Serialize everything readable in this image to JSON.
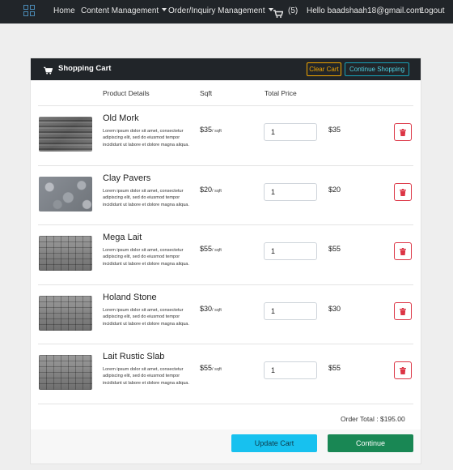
{
  "nav": {
    "home": "Home",
    "content_management": "Content Management",
    "order_management": "Order/Inquiry Management",
    "cart_count": "(5)",
    "greeting": "Hello baadshaah18@gmail.com!",
    "logout": "Logout"
  },
  "cart": {
    "title": "Shopping Cart",
    "clear_label": "Clear Cart",
    "continue_shopping_label": "Continue Shopping",
    "columns": {
      "product": "Product Details",
      "sqft": "Sqft",
      "total": "Total Price"
    },
    "items": [
      {
        "name": "Old Mork",
        "desc": "Lorem ipsum dolor sit amet, consectetur adipiscing elit, sed do eiusmod tempor incididunt ut labore et dolore magna aliqua.",
        "price": "$35",
        "unit": "/ sqft",
        "qty": "1",
        "total": "$35",
        "thumb": "stone1"
      },
      {
        "name": "Clay Pavers",
        "desc": "Lorem ipsum dolor sit amet, consectetur adipiscing elit, sed do eiusmod tempor incididunt ut labore et dolore magna aliqua.",
        "price": "$20",
        "unit": "/ sqft",
        "qty": "1",
        "total": "$20",
        "thumb": "stone2"
      },
      {
        "name": "Mega Lait",
        "desc": "Lorem ipsum dolor sit amet, consectetur adipiscing elit, sed do eiusmod tempor incididunt ut labore et dolore magna aliqua.",
        "price": "$55",
        "unit": "/ sqft",
        "qty": "1",
        "total": "$55",
        "thumb": "paver"
      },
      {
        "name": "Holand Stone",
        "desc": "Lorem ipsum dolor sit amet, consectetur adipiscing elit, sed do eiusmod tempor incididunt ut labore et dolore magna aliqua.",
        "price": "$30",
        "unit": "/ sqft",
        "qty": "1",
        "total": "$30",
        "thumb": "paver"
      },
      {
        "name": "Lait Rustic Slab",
        "desc": "Lorem ipsum dolor sit amet, consectetur adipiscing elit, sed do eiusmod tempor incididunt ut labore et dolore magna aliqua.",
        "price": "$55",
        "unit": "/ sqft",
        "qty": "1",
        "total": "$55",
        "thumb": "paver"
      }
    ],
    "order_total": "Order Total : $195.00",
    "update_label": "Update Cart",
    "checkout_label": "Continue"
  },
  "icons": {
    "brand": "grid-icon",
    "cart": "cart-icon",
    "delete": "trash-icon"
  },
  "colors": {
    "navbar": "#212529",
    "clear_button": "#f0a500",
    "info": "#17a2b8",
    "danger": "#dc3545",
    "update_button": "#17c1ef",
    "checkout_button": "#198754"
  }
}
